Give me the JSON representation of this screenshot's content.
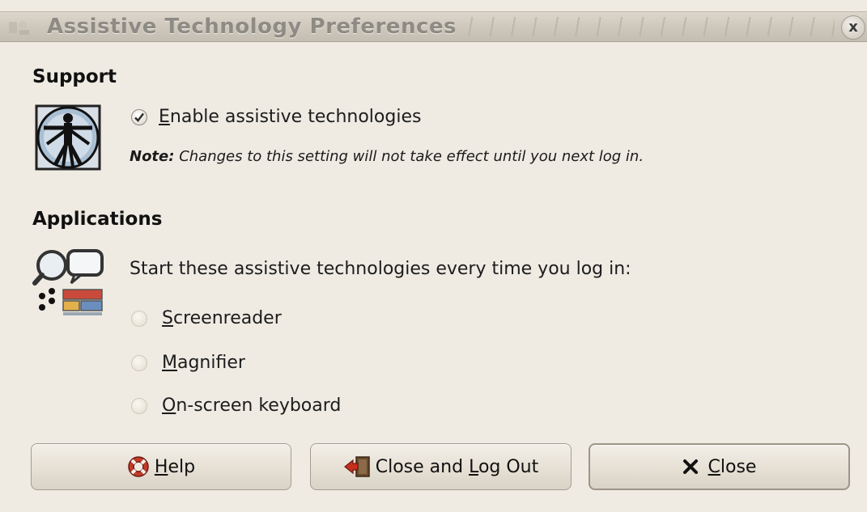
{
  "window": {
    "title": "Assistive Technology Preferences",
    "close_glyph": "x"
  },
  "support": {
    "heading": "Support",
    "icon": "vitruvian-man-icon",
    "checkbox": {
      "mnemonic": "E",
      "label_rest": "nable assistive technologies",
      "checked": true
    },
    "note_label": "Note:",
    "note_text": "Changes to this setting will not take effect until you next log in."
  },
  "applications": {
    "heading": "Applications",
    "icon": "assistive-apps-icon",
    "intro": "Start these assistive technologies every time you log in:",
    "options": [
      {
        "mnemonic": "S",
        "label_rest": "creenreader",
        "checked": false,
        "enabled": false
      },
      {
        "mnemonic": "M",
        "label_rest": "agnifier",
        "checked": false,
        "enabled": false
      },
      {
        "mnemonic": "O",
        "label_rest": "n-screen keyboard",
        "checked": false,
        "enabled": false
      }
    ]
  },
  "buttons": {
    "help": {
      "mnemonic": "H",
      "label_rest": "elp",
      "icon": "lifebuoy-icon"
    },
    "close_logout": {
      "before": "Close and ",
      "mnemonic": "L",
      "label_rest": "og Out",
      "icon": "logout-door-icon"
    },
    "close": {
      "mnemonic": "C",
      "label_rest": "lose",
      "icon": "close-x-icon"
    }
  },
  "colors": {
    "window_bg": "#efebe3",
    "titlebar": "#cfc8bd",
    "check_mark": "#c0392b"
  }
}
